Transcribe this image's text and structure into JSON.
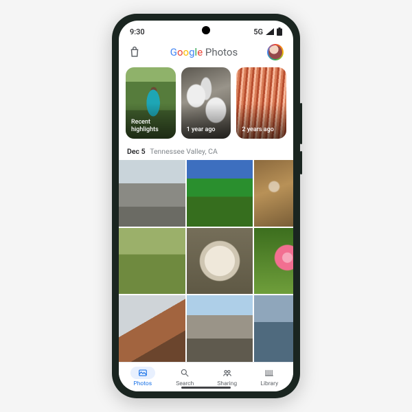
{
  "status": {
    "time": "9:30",
    "network": "5G"
  },
  "header": {
    "title_google": "Google",
    "title_rest": "Photos"
  },
  "memories": [
    {
      "label": "Recent highlights"
    },
    {
      "label": "1 year ago"
    },
    {
      "label": "2 years ago"
    }
  ],
  "section": {
    "date": "Dec 5",
    "location": "Tennessee Valley, CA"
  },
  "nav": {
    "photos": "Photos",
    "search": "Search",
    "sharing": "Sharing",
    "library": "Library"
  }
}
